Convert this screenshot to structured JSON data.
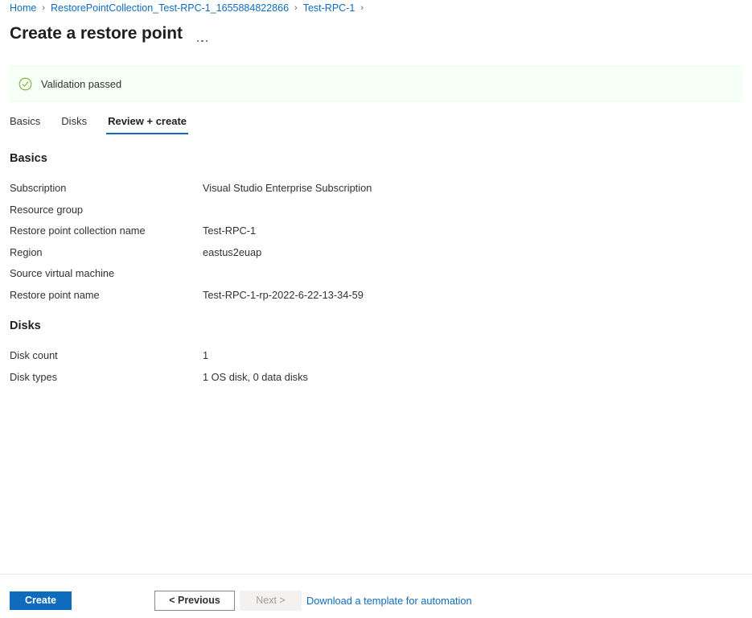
{
  "breadcrumb": {
    "separator": "›",
    "items": [
      {
        "label": "Home"
      },
      {
        "label": "RestorePointCollection_Test-RPC-1_1655884822866"
      },
      {
        "label": "Test-RPC-1"
      }
    ],
    "trailing_separator": "›"
  },
  "header": {
    "title": "Create a restore point",
    "more_menu_name": "more-options"
  },
  "validation": {
    "icon": "check-circle-icon",
    "message": "Validation passed",
    "background_color": "#f6fff6",
    "icon_color": "#73aa24"
  },
  "tabs": [
    {
      "label": "Basics",
      "active": false
    },
    {
      "label": "Disks",
      "active": false
    },
    {
      "label": "Review + create",
      "active": true
    }
  ],
  "sections": [
    {
      "heading": "Basics",
      "rows": [
        {
          "label": "Subscription",
          "value": "Visual Studio Enterprise Subscription"
        },
        {
          "label": "Resource group",
          "value": ""
        },
        {
          "label": "Restore point collection name",
          "value": "Test-RPC-1"
        },
        {
          "label": "Region",
          "value": "eastus2euap"
        },
        {
          "label": "Source virtual machine",
          "value": ""
        },
        {
          "label": "Restore point name",
          "value": "Test-RPC-1-rp-2022-6-22-13-34-59"
        }
      ]
    },
    {
      "heading": "Disks",
      "rows": [
        {
          "label": "Disk count",
          "value": "1"
        },
        {
          "label": "Disk types",
          "value": "1 OS disk, 0 data disks"
        }
      ]
    }
  ],
  "footer": {
    "create_label": "Create",
    "previous_label": "< Previous",
    "next_label": "Next >",
    "next_disabled": true,
    "template_link_label": "Download a template for automation"
  },
  "colors": {
    "accent": "#0f6cbd",
    "link": "#0f6cbd",
    "text": "#323130",
    "success": "#73aa24",
    "success_bg": "#f6fff6",
    "disabled_bg": "#f3f2f1",
    "disabled_text": "#a19f9d"
  }
}
